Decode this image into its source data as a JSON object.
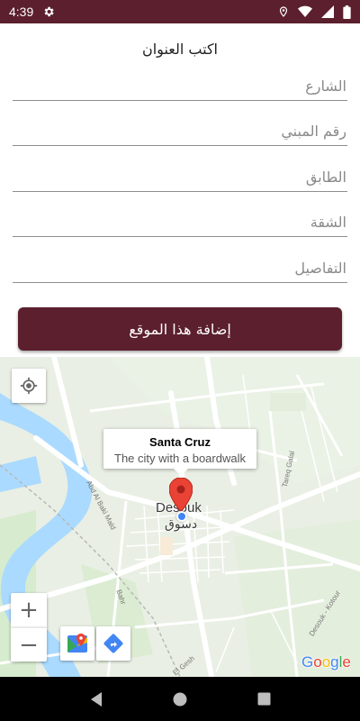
{
  "status_bar": {
    "time": "4:39",
    "icons": [
      "settings-icon",
      "location-icon",
      "wifi-icon",
      "signal-icon",
      "battery-icon"
    ],
    "color": "#5b1f2d"
  },
  "form": {
    "title": "اكتب العنوان",
    "fields": [
      {
        "name": "street",
        "placeholder": "الشارع",
        "value": ""
      },
      {
        "name": "building",
        "placeholder": "رقم المبني",
        "value": ""
      },
      {
        "name": "floor",
        "placeholder": "الطابق",
        "value": ""
      },
      {
        "name": "apartment",
        "placeholder": "الشقة",
        "value": ""
      },
      {
        "name": "details",
        "placeholder": "التفاصيل",
        "value": ""
      }
    ],
    "submit_label": "إضافة هذا الموقع",
    "accent_color": "#5b1f2d"
  },
  "map": {
    "info_window": {
      "title": "Santa Cruz",
      "snippet": "The city with a boardwalk"
    },
    "city_label_en": "Desouk",
    "city_label_ar": "دسوق",
    "road_labels": {
      "abd_al_baki": "Abd Al Baki Mald",
      "tareq_galal": "Tareq Galal",
      "desouk_kotour": "Desouk - Kotour",
      "el_gesh": "El Gesh",
      "bahr": "Bahr"
    },
    "controls": [
      "my-location-icon",
      "zoom-in-icon",
      "zoom-out-icon",
      "google-maps-icon",
      "directions-icon"
    ],
    "zoom_in_label": "+",
    "zoom_out_label": "−",
    "attribution": "Google",
    "water_color": "#aadaff",
    "land_color": "#eef1ea",
    "park_color": "#c8e6c0"
  },
  "nav_bar": {
    "buttons": [
      "back-icon",
      "home-icon",
      "recents-icon"
    ]
  }
}
